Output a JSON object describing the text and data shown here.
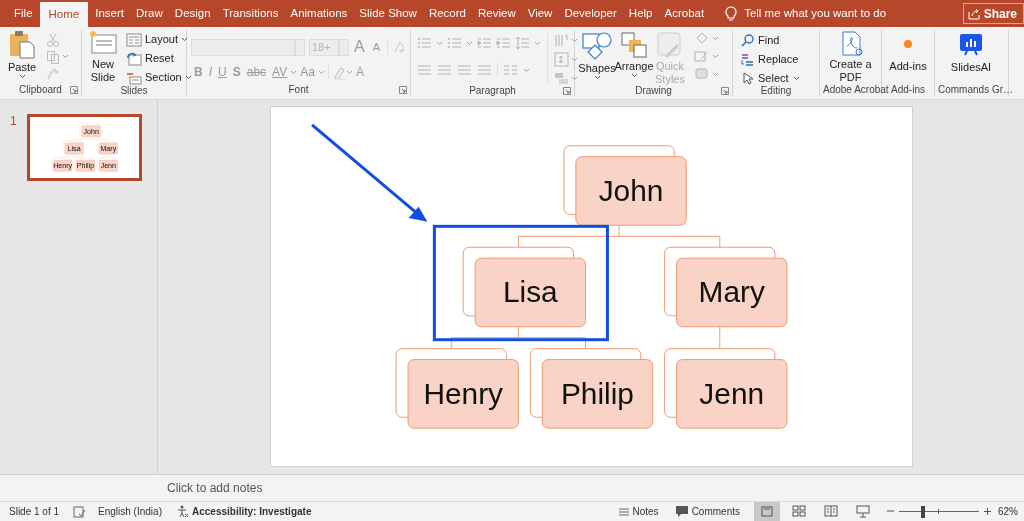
{
  "tabs": [
    {
      "label": "File",
      "selected": false
    },
    {
      "label": "Home",
      "selected": true
    },
    {
      "label": "Insert",
      "selected": false
    },
    {
      "label": "Draw",
      "selected": false
    },
    {
      "label": "Design",
      "selected": false
    },
    {
      "label": "Transitions",
      "selected": false
    },
    {
      "label": "Animations",
      "selected": false
    },
    {
      "label": "Slide Show",
      "selected": false
    },
    {
      "label": "Record",
      "selected": false
    },
    {
      "label": "Review",
      "selected": false
    },
    {
      "label": "View",
      "selected": false
    },
    {
      "label": "Developer",
      "selected": false
    },
    {
      "label": "Help",
      "selected": false
    },
    {
      "label": "Acrobat",
      "selected": false
    }
  ],
  "tell_me": {
    "placeholder": "Tell me what you want to do"
  },
  "share_button": "Share",
  "ribbon": {
    "clipboard": {
      "label": "Clipboard",
      "paste": "Paste",
      "tools": [
        {
          "disabled": true
        },
        {
          "disabled": true
        },
        {
          "disabled": true
        }
      ]
    },
    "slides": {
      "label": "Slides",
      "new_slide": "New Slide",
      "items": [
        "Layout",
        "Reset",
        "Section"
      ]
    },
    "font": {
      "label": "Font",
      "disabled": true,
      "size": "18+",
      "size_buttons": [
        "A",
        "A"
      ],
      "buttons": [
        "B",
        "I",
        "U",
        "S",
        "abc",
        "AV",
        "Aa",
        "A"
      ]
    },
    "paragraph": {
      "label": "Paragraph",
      "disabled": true
    },
    "drawing": {
      "label": "Drawing",
      "buttons": [
        {
          "label": "Shapes",
          "disabled": false
        },
        {
          "label": "Arrange",
          "disabled": false
        },
        {
          "label": "Quick Styles",
          "disabled": true
        }
      ]
    },
    "editing": {
      "label": "Editing",
      "buttons": [
        "Find",
        "Replace",
        "Select"
      ]
    },
    "acrobat": {
      "label": "Adobe Acrobat",
      "button": "Create a PDF"
    },
    "addins": {
      "label": "Add-ins",
      "button": "Add-ins"
    },
    "commands": {
      "label": "Commands Gr…",
      "button": "SlidesAI"
    }
  },
  "thumbnails": [
    {
      "number": "1",
      "selected": true,
      "org_chart": {
        "name": "John",
        "children": [
          {
            "name": "Lisa",
            "children": [
              {
                "name": "Henry"
              },
              {
                "name": "Philip"
              }
            ]
          },
          {
            "name": "Mary",
            "children": [
              {
                "name": "Jenn"
              }
            ]
          }
        ]
      }
    }
  ],
  "slide": {
    "org_chart": {
      "name": "John",
      "highlighted": false,
      "children": [
        {
          "name": "Lisa",
          "highlighted": true,
          "children": [
            {
              "name": "Henry",
              "highlighted": false
            },
            {
              "name": "Philip",
              "highlighted": false
            }
          ]
        },
        {
          "name": "Mary",
          "highlighted": false,
          "children": [
            {
              "name": "Jenn",
              "highlighted": false
            }
          ]
        }
      ]
    }
  },
  "notes": {
    "placeholder": "Click to add notes"
  },
  "status_bar": {
    "slide": "Slide 1 of 1",
    "language": "English (India)",
    "accessibility": "Accessibility: Investigate",
    "notes": "Notes",
    "comments": "Comments",
    "views": [
      {
        "selected": true
      },
      {
        "selected": false
      },
      {
        "selected": false
      },
      {
        "selected": false
      }
    ],
    "zoom": {
      "level": 0.3,
      "reading": "62%"
    }
  }
}
